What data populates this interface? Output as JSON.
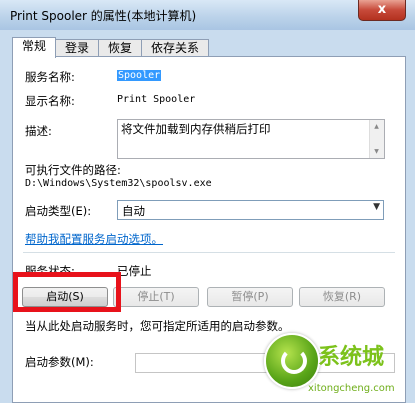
{
  "window": {
    "title": "Print Spooler 的属性(本地计算机)",
    "close_label": "x"
  },
  "tabs": [
    {
      "label": "常规",
      "active": true
    },
    {
      "label": "登录"
    },
    {
      "label": "恢复"
    },
    {
      "label": "依存关系"
    }
  ],
  "general": {
    "service_name_label": "服务名称:",
    "service_name_value": "Spooler",
    "display_name_label": "显示名称:",
    "display_name_value": "Print Spooler",
    "description_label": "描述:",
    "description_value": "将文件加载到内存供稍后打印",
    "exe_path_label": "可执行文件的路径:",
    "exe_path_value": "D:\\Windows\\System32\\spoolsv.exe",
    "startup_type_label": "启动类型(E):",
    "startup_type_value": "自动",
    "help_link": "帮助我配置服务启动选项。",
    "service_status_label": "服务状态:",
    "service_status_value": "已停止",
    "buttons": {
      "start": "启动(S)",
      "stop": "停止(T)",
      "pause": "暂停(P)",
      "resume": "恢复(R)"
    },
    "hint_text": "当从此处启动服务时，您可指定所适用的启动参数。",
    "start_params_label": "启动参数(M):"
  },
  "watermark": {
    "brand_text": "系统城",
    "url_text": "xitongcheng.com"
  },
  "colors": {
    "highlight": "#e8121b",
    "selection": "#3399ff",
    "link": "#0066cc"
  }
}
